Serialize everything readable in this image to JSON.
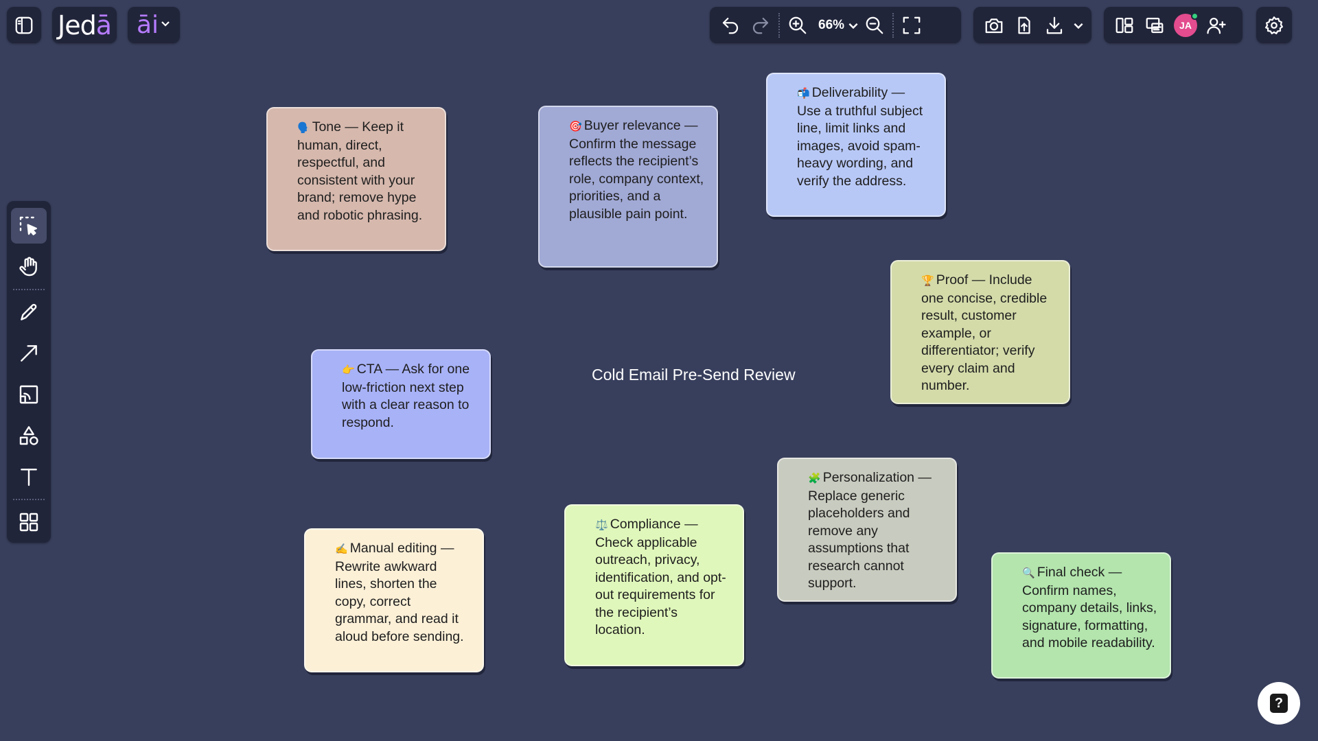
{
  "app": {
    "brand_prefix": "Jed",
    "brand_accent": "ā",
    "ai_label": "āi"
  },
  "toolbar_top": {
    "zoom_label": "66%",
    "avatar_initials": "JA"
  },
  "board": {
    "title": "Cold Email Pre-Send Review",
    "notes": [
      {
        "icon": "🗣️",
        "text": "Tone — Keep it human, direct, respectful, and consistent with your brand; remove hype and robotic phrasing.",
        "color": "#d6b8ad"
      },
      {
        "icon": "🎯",
        "text": "Buyer relevance — Confirm the message reflects the recipient’s role, company context, priorities, and a plausible pain point.",
        "color": "#a1a9d5"
      },
      {
        "icon": "📬",
        "text": "Deliverability — Use a truthful subject line, limit links and images, avoid spam-heavy wording, and verify the address.",
        "color": "#b8c8f6"
      },
      {
        "icon": "🏆",
        "text": "Proof — Include one concise, credible result, customer example, or differentiator; verify every claim and number.",
        "color": "#d4dba9"
      },
      {
        "icon": "👉",
        "text": "CTA — Ask for one low-friction next step with a clear reason to respond.",
        "color": "#a8b2f7"
      },
      {
        "icon": "🧩",
        "text": "Personalization — Replace generic placeholders and remove any assumptions that research cannot support.",
        "color": "#c8cbbf"
      },
      {
        "icon": "✍️",
        "text": "Manual editing — Rewrite awkward lines, shorten the copy, correct grammar, and read it aloud before sending.",
        "color": "#fcf0d7"
      },
      {
        "icon": "⚖️",
        "text": "Compliance — Check applicable outreach, privacy, identification, and opt-out requirements for the recipient’s location.",
        "color": "#e0f7bb"
      },
      {
        "icon": "🔍",
        "text": "Final check — Confirm names, company details, links, signature, formatting, and mobile readability.",
        "color": "#b3e5ad"
      }
    ]
  },
  "colors": {
    "canvas_bg": "#383f5c",
    "panel_bg": "#21253a",
    "brand_accent": "#b67cff",
    "avatar_bg": "#e34c8e",
    "presence_dot": "#35d07f"
  },
  "help": {
    "label": "?"
  }
}
